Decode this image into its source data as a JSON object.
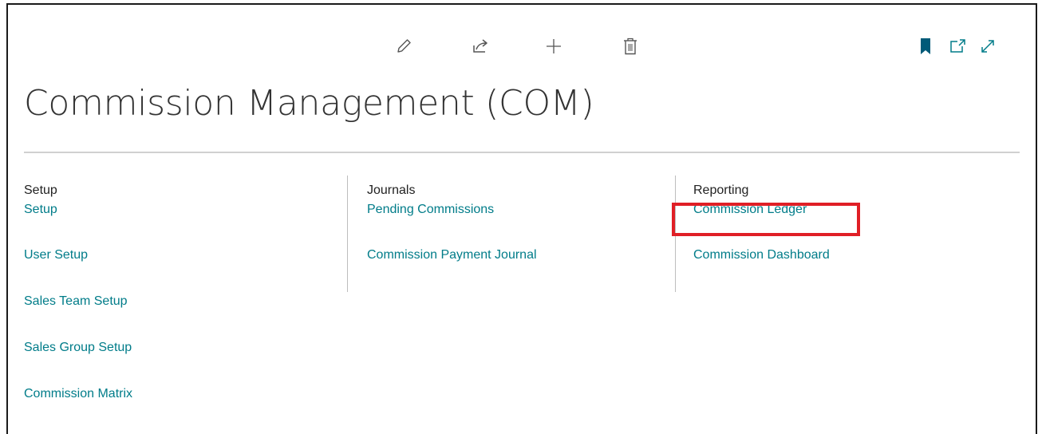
{
  "header": {
    "top_clip_text": "",
    "title": "Commission Management (COM)"
  },
  "actions": {
    "left": [
      "edit-icon",
      "share-icon",
      "add-icon",
      "delete-icon"
    ],
    "right": [
      "bookmark-icon",
      "open-new-window-icon",
      "expand-icon"
    ]
  },
  "columns": [
    {
      "title": "Setup",
      "links": [
        "Setup",
        "User Setup",
        "Sales Team Setup",
        "Sales Group Setup",
        "Commission Matrix"
      ]
    },
    {
      "title": "Journals",
      "links": [
        "Pending Commissions",
        "Commission Payment Journal"
      ]
    },
    {
      "title": "Reporting",
      "links": [
        "Commission Ledger",
        "Commission Dashboard"
      ]
    }
  ],
  "highlight": {
    "target": "Commission Ledger",
    "color": "#e01f26"
  },
  "colors": {
    "link": "#007C89",
    "title": "#333333",
    "icon": "#505050",
    "bookmark": "#005A78"
  }
}
